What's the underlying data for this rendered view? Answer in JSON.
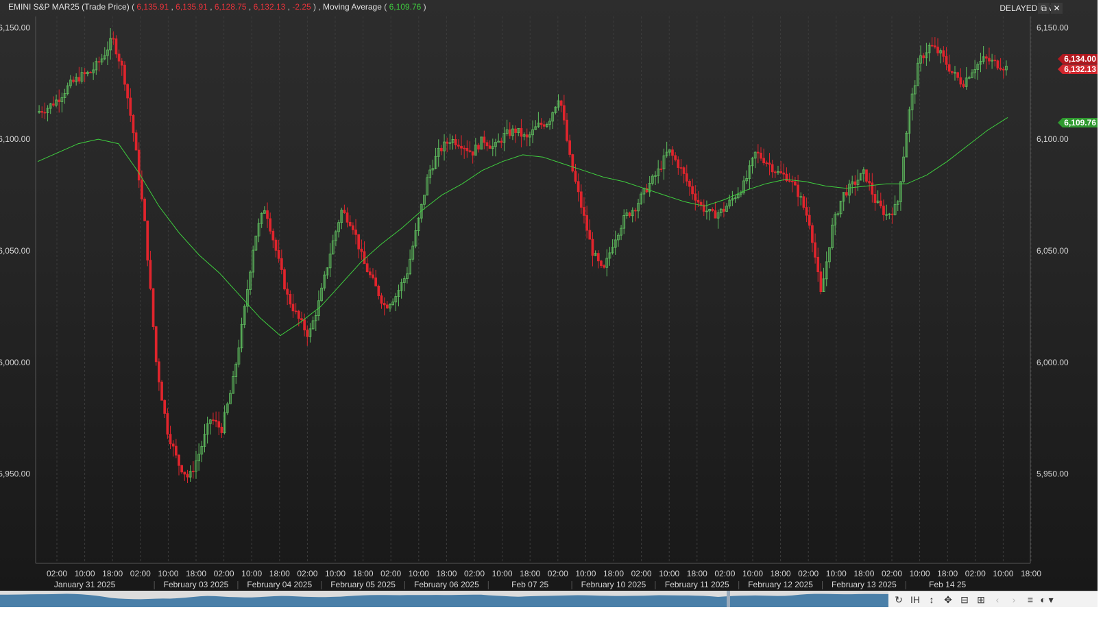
{
  "header": {
    "instrument": "EMINI S&P MAR25 (Trade Price)",
    "open": "6,135.91",
    "high": "6,135.91",
    "low": "6,128.75",
    "close": "6,132.13",
    "change": "-2.25",
    "indicator_label": "Moving Average",
    "indicator_value": "6,109.76",
    "delayed_label": "DELAYED DATA"
  },
  "window_buttons": {
    "restore_icon": "restore-icon",
    "close_icon": "close-icon",
    "restore_glyph": "⧉",
    "close_glyph": "✕"
  },
  "price_tags": {
    "ask": "6,134.00",
    "last": "6,132.13",
    "ma": "6,109.76"
  },
  "colors": {
    "up": "#5fbf5f",
    "down": "#e0252d",
    "ma_line": "#3fd03f",
    "grid": "#3c3c3c",
    "axis_text": "#d6d6d6",
    "navigator": "#4a7fa8"
  },
  "chart_data": {
    "type": "candlestick",
    "ylim": [
      5910,
      6155
    ],
    "y_ticks": [
      "6,150.00",
      "6,100.00",
      "6,050.00",
      "6,000.00",
      "5,950.00"
    ],
    "y_tick_values": [
      6150,
      6100,
      6050,
      6000,
      5950
    ],
    "time_labels": [
      "02:00",
      "10:00",
      "18:00",
      "02:00",
      "10:00",
      "18:00",
      "02:00",
      "10:00",
      "18:00",
      "02:00",
      "10:00",
      "18:00",
      "02:00",
      "10:00",
      "18:00",
      "02:00",
      "10:00",
      "18:00",
      "02:00",
      "10:00",
      "18:00",
      "02:00",
      "10:00",
      "18:00",
      "02:00",
      "10:00",
      "18:00",
      "02:00",
      "10:00",
      "18:00",
      "02:00",
      "10:00",
      "18:00",
      "02:00",
      "10:00",
      "18:00"
    ],
    "date_labels": [
      "January 31 2025",
      "February 03 2025",
      "February 04 2025",
      "February 05 2025",
      "February 06 2025",
      "Feb 07 25",
      "February 10 2025",
      "February 11 2025",
      "February 12 2025",
      "February 13 2025",
      "Feb 14 25"
    ],
    "price_path": [
      6112,
      6114,
      6118,
      6124,
      6128,
      6130,
      6136,
      6145,
      6130,
      6100,
      6060,
      6000,
      5970,
      5955,
      5948,
      5960,
      5975,
      5970,
      5990,
      6020,
      6055,
      6070,
      6050,
      6030,
      6020,
      6012,
      6028,
      6050,
      6068,
      6062,
      6045,
      6035,
      6025,
      6030,
      6040,
      6062,
      6085,
      6095,
      6100,
      6098,
      6094,
      6100,
      6096,
      6102,
      6104,
      6100,
      6106,
      6108,
      6120,
      6090,
      6070,
      6050,
      6040,
      6055,
      6065,
      6070,
      6078,
      6085,
      6095,
      6088,
      6078,
      6070,
      6066,
      6068,
      6074,
      6080,
      6094,
      6090,
      6085,
      6083,
      6075,
      6062,
      6030,
      6060,
      6075,
      6080,
      6085,
      6072,
      6066,
      6070,
      6110,
      6135,
      6142,
      6138,
      6130,
      6125,
      6132,
      6136,
      6134,
      6132.13
    ],
    "moving_average": [
      6090,
      6094,
      6098,
      6100,
      6098,
      6085,
      6070,
      6058,
      6048,
      6040,
      6030,
      6020,
      6012,
      6018,
      6025,
      6035,
      6045,
      6053,
      6060,
      6068,
      6075,
      6080,
      6086,
      6090,
      6093,
      6092,
      6089,
      6086,
      6083,
      6081,
      6078,
      6075,
      6072,
      6070,
      6073,
      6077,
      6080,
      6082,
      6081,
      6079,
      6078,
      6079,
      6080,
      6080,
      6084,
      6090,
      6097,
      6104,
      6109.76
    ],
    "last_price": 6132.13,
    "ma_last": 6109.76
  },
  "toolbar": {
    "items": [
      {
        "name": "refresh-icon",
        "glyph": "↻",
        "enabled": true
      },
      {
        "name": "chart-type-icon",
        "glyph": "IH ▾",
        "enabled": true
      },
      {
        "name": "vertical-zoom-icon",
        "glyph": "↕",
        "enabled": true
      },
      {
        "name": "pan-icon",
        "glyph": "✥",
        "enabled": true
      },
      {
        "name": "zoom-out-icon",
        "glyph": "⊟",
        "enabled": true
      },
      {
        "name": "zoom-in-icon",
        "glyph": "⊞",
        "enabled": true
      },
      {
        "name": "back-icon",
        "glyph": "‹",
        "enabled": false
      },
      {
        "name": "forward-icon",
        "glyph": "›",
        "enabled": false
      },
      {
        "name": "menu-icon",
        "glyph": "≡",
        "enabled": true
      },
      {
        "name": "palette-icon",
        "glyph": "◐ ▾",
        "enabled": true
      }
    ]
  }
}
